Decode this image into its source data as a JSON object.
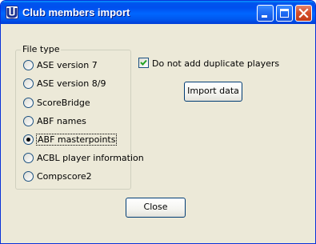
{
  "window": {
    "title": "Club members import",
    "controls": [
      "minimize-icon",
      "maximize-icon",
      "close-icon"
    ],
    "colors": {
      "titlebar": "#0054e3",
      "face": "#ece9d8",
      "close_button": "#d64f2c"
    }
  },
  "file_type": {
    "legend": "File type",
    "selected": "ABF masterpoints",
    "options": [
      "ASE version 7",
      "ASE version 8/9",
      "ScoreBridge",
      "ABF names",
      "ABF masterpoints",
      "ACBL player information",
      "Compscore2"
    ]
  },
  "options": {
    "no_duplicates_label": "Do not add duplicate players",
    "no_duplicates_checked": true
  },
  "buttons": {
    "import": "Import data",
    "close": "Close"
  }
}
